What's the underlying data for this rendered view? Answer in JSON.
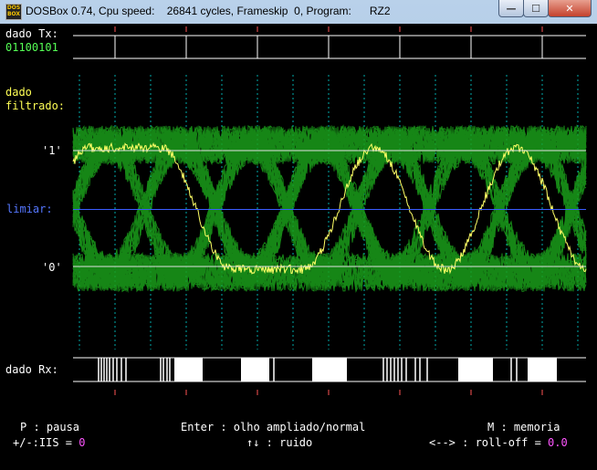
{
  "window": {
    "title": "DOSBox 0.74, Cpu speed:    26841 cycles, Frameskip  0, Program:      RZ2",
    "icon_text": "DOS BOX",
    "buttons": [
      "minimize-icon",
      "maximize-icon",
      "close-icon"
    ]
  },
  "tx": {
    "label": "dado Tx:",
    "bits": "01100101"
  },
  "filtered": {
    "label_line1": "dado",
    "label_line2": "filtrado:"
  },
  "levels": {
    "one": "'1'",
    "threshold": "limiar:",
    "zero": "'0'"
  },
  "rx": {
    "label": "dado Rx:"
  },
  "footer": {
    "pause": "P : pausa",
    "eye": "Enter : olho ampliado/normal",
    "memory": "M : memoria",
    "isi_label": "+/-:IIS = ",
    "isi_value": "0",
    "noise": "↑↓ : ruido",
    "rolloff_label": "<--> : roll-off = ",
    "rolloff_value": "0.0"
  },
  "colors": {
    "background": "#000000",
    "eye_traces": "#1a9e1a",
    "highlight_trace": "#ffff66",
    "threshold_line": "#3a5cff",
    "value": "#ff55ff",
    "ticks": "#ff5555",
    "dotted": "#00aaaa"
  }
}
